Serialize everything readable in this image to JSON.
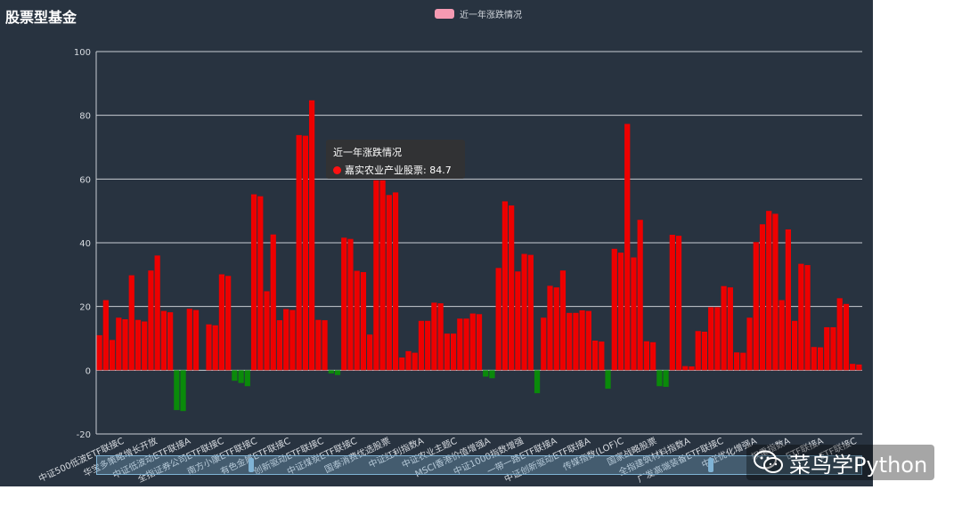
{
  "title": "股票型基金",
  "tooltip": {
    "title": "近一年涨跌情况",
    "label": "嘉实农业产业股票: 84.7"
  },
  "watermark": {
    "text": "菜鸟学Python"
  },
  "colors": {
    "background": "#283340",
    "positive": "#ee0000",
    "negative": "#0a8a0a",
    "legend": "#f59ab2",
    "grid": "#c8cdd3"
  },
  "chart_data": {
    "type": "bar",
    "title": "股票型基金",
    "legend": {
      "entries": [
        "近一年涨跌情况"
      ],
      "placement": "top-center"
    },
    "ylim": [
      -20,
      100
    ],
    "yticks": [
      -20,
      0,
      20,
      40,
      60,
      80,
      100
    ],
    "grid": true,
    "x_tick_labels": [
      "中证500低波ETF联接C",
      "华宝多策略增长开放",
      "中证低波动ETF联接A",
      "全指证券公司ETF联接C",
      "南方小康ETF联接C",
      "有色金属ETF联接C",
      "创新驱动ETF联接C",
      "中证煤炭ETF联接C",
      "国泰消费优选股票",
      "中证红利指数A",
      "中证农业主题C",
      "MSCI香港价值增强A",
      "中证1000指数增强",
      "一带一路ETF联接A",
      "中证创新驱动ETF联接A",
      "传媒指数(LOF)C",
      "国家战略股票",
      "全指建筑材料指数A",
      "广发高端装备ETF联接C",
      "中证优化增强A",
      "权重指数A",
      "ETF联接A",
      "ETF联接C"
    ],
    "series": [
      {
        "name": "近一年涨跌情况",
        "highlight": {
          "index": 26,
          "name": "嘉实农业产业股票",
          "value": 84.7
        },
        "values": [
          11,
          22,
          9.5,
          16.5,
          16,
          29.8,
          15.8,
          15.3,
          31.3,
          36,
          18.6,
          18.2,
          -12.5,
          -12.8,
          19.3,
          18.9,
          0,
          14.4,
          14.1,
          30.1,
          29.6,
          -3.3,
          -4,
          -5,
          55.2,
          54.6,
          24.8,
          42.6,
          15.7,
          19.2,
          18.9,
          73.8,
          73.6,
          84.7,
          15.8,
          15.7,
          -1,
          -1.5,
          41.6,
          41.2,
          31.2,
          30.8,
          11.2,
          59.6,
          59.6,
          55,
          55.8,
          4,
          6,
          5.5,
          15.5,
          15.5,
          21.2,
          21,
          11.5,
          11.5,
          16.2,
          16.2,
          17.8,
          17.6,
          -2,
          -2.5,
          32.1,
          53,
          51.7,
          31,
          36.5,
          36.2,
          -7.2,
          16.5,
          26.5,
          26,
          31.3,
          18,
          18,
          18.8,
          18.6,
          9.3,
          9,
          -5.8,
          38.1,
          36.9,
          77.3,
          35.4,
          47.2,
          9.1,
          8.8,
          -5,
          -5.2,
          42.5,
          42.2,
          1.3,
          1.2,
          12.3,
          12.1,
          19.8,
          19.8,
          26.4,
          26,
          5.6,
          5.5,
          16.5,
          40.2,
          45.8,
          50,
          49.1,
          22,
          44.2,
          15.5,
          33.4,
          33,
          7.3,
          7.2,
          13.5,
          13.5,
          22.6,
          20.8,
          2,
          1.8
        ]
      }
    ]
  }
}
